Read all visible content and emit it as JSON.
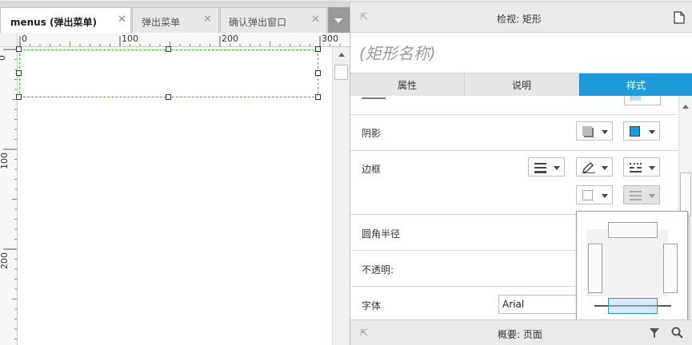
{
  "tabs": [
    {
      "label": "menus (弹出菜单)",
      "active": true
    },
    {
      "label": "弹出菜单",
      "active": false
    },
    {
      "label": "确认弹出窗口",
      "active": false
    }
  ],
  "ruler": {
    "h_ticks": [
      "0",
      "100",
      "200",
      "300"
    ],
    "v_ticks": [
      "0",
      "100",
      "200"
    ]
  },
  "inspector": {
    "title": "检视: 矩形",
    "name_placeholder": "(矩形名称)",
    "tabs": [
      "属性",
      "说明",
      "样式"
    ],
    "active_tab": "样式",
    "sections": {
      "shadow": "阴影",
      "border": "边框",
      "corner_radius": "圆角半径",
      "opacity": "不透明:",
      "font": "字体"
    },
    "font_value": "Arial"
  },
  "bottom_panel": {
    "title": "概要: 页面"
  },
  "colors": {
    "accent": "#1e9bd7",
    "selection": "#22c222"
  }
}
